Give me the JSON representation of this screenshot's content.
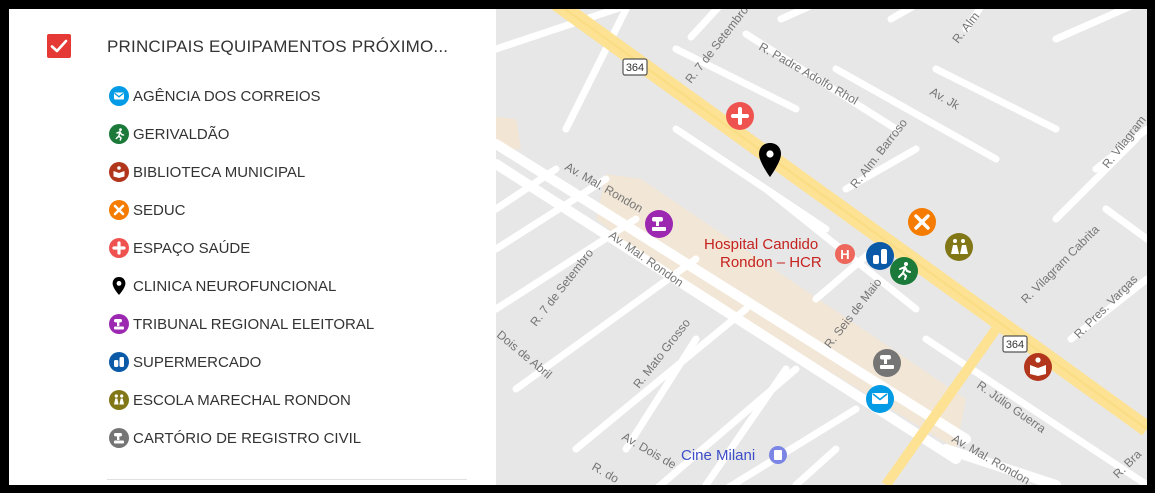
{
  "layer": {
    "title": "PRINCIPAIS EQUIPAMENTOS PRÓXIMO...",
    "checked": true,
    "check_color": "#e53935"
  },
  "legend": [
    {
      "label": "AGÊNCIA DOS CORREIOS",
      "icon": "envelope-icon",
      "color": "#039be5"
    },
    {
      "label": "GERIVALDÃO",
      "icon": "runner-icon",
      "color": "#1b7a3a"
    },
    {
      "label": "BIBLIOTECA MUNICIPAL",
      "icon": "book-icon",
      "color": "#b2361c"
    },
    {
      "label": "SEDUC",
      "icon": "cross-x-icon",
      "color": "#f57c00"
    },
    {
      "label": "ESPAÇO SAÚDE",
      "icon": "medical-cross-icon",
      "color": "#ef5350"
    },
    {
      "label": "CLINICA NEUROFUNCIONAL",
      "icon": "map-pin-icon",
      "color": "#000000"
    },
    {
      "label": "TRIBUNAL REGIONAL ELEITORAL",
      "icon": "gavel-icon",
      "color": "#9c27b0"
    },
    {
      "label": "SUPERMERCADO",
      "icon": "shopping-icon",
      "color": "#0b5aa8"
    },
    {
      "label": "ESCOLA MARECHAL RONDON",
      "icon": "children-icon",
      "color": "#827717"
    },
    {
      "label": "CARTÓRIO DE REGISTRO CIVIL",
      "icon": "stamp-icon",
      "color": "#757575"
    }
  ],
  "map": {
    "streets": {
      "r7setembro_top": "R. 7 de Setembro",
      "padre": "R. Padre Adolfo Rhol",
      "barroso": "R. Alm. Barroso",
      "avjk": "Av. Jk",
      "vilagram_top": "R. Vilagram",
      "almt": "R. Alm",
      "malrondon1": "Av. Mal. Rondon",
      "malrondon2": "Av. Mal. Rondon",
      "r7setembro": "R. 7 de Setembro",
      "seis": "R. Seis de Maio",
      "vilagramcabrita": "R. Vilagram Cabrita",
      "presvargas": "R. Pres. Vargas",
      "dois": "Dois de Abril",
      "matogrosso": "R. Mato Grosso",
      "julio": "R. Júlio Guerra",
      "malrondon3": "Av. Mal. Rondon",
      "avdois": "Av. Dois de",
      "rdo": "R. do",
      "rbra": "R. Bra"
    },
    "route_shields": [
      "364",
      "364"
    ],
    "hospital": [
      "Hospital Candido",
      "Rondon – HCR"
    ],
    "cinema": "Cine Milani"
  }
}
